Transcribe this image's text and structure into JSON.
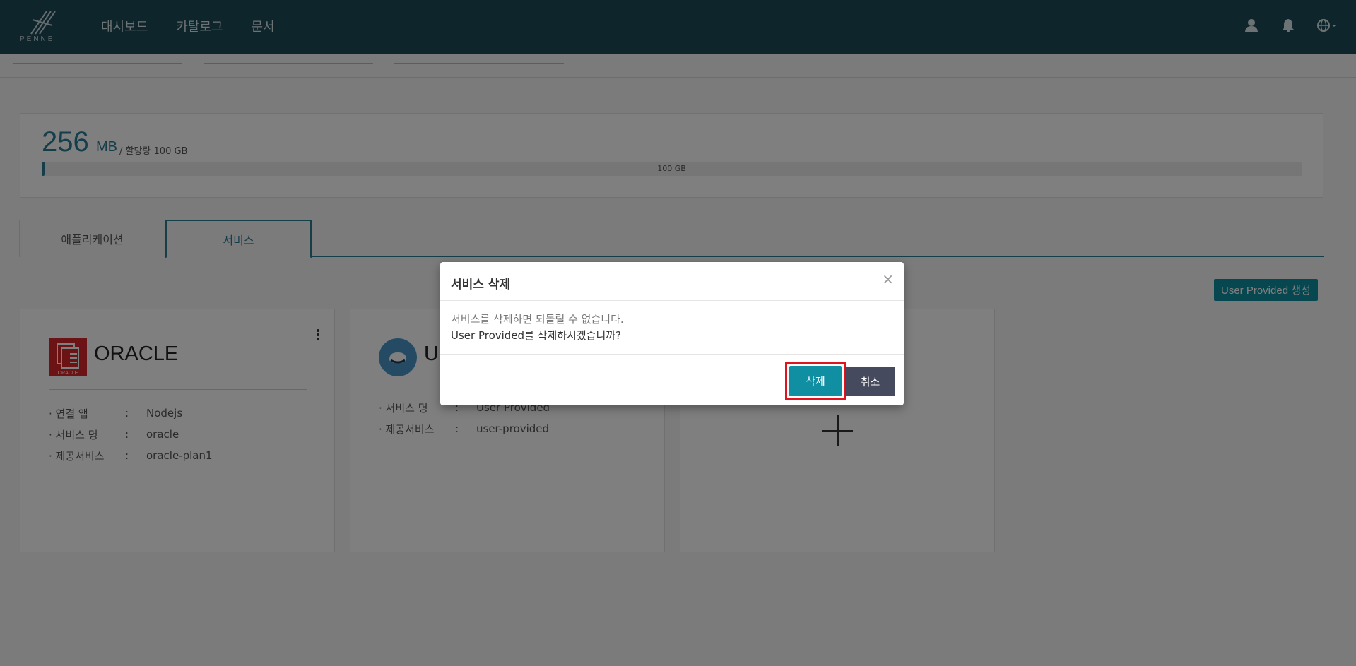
{
  "nav": {
    "logo_text": "PENNE",
    "menu": [
      "대시보드",
      "카탈로그",
      "문서"
    ]
  },
  "usage": {
    "used_value": "256",
    "used_unit": "MB",
    "allocation": "/ 할당량 100 GB",
    "bar_label": "100 GB",
    "used_fraction": 0.0025
  },
  "tabs": [
    "애플리케이션",
    "서비스"
  ],
  "create_button": "User Provided 생성",
  "cards": [
    {
      "name": "ORACLE",
      "logo_caption": "ORACLE",
      "rows": [
        {
          "key": "· 연결 앱",
          "value": "Nodejs"
        },
        {
          "key": "· 서비스 명",
          "value": "oracle"
        },
        {
          "key": "· 제공서비스",
          "value": "oracle-plan1"
        }
      ]
    },
    {
      "name": "U",
      "rows": [
        {
          "key": "· 서비스 명",
          "value": "User Provided"
        },
        {
          "key": "· 제공서비스",
          "value": "user-provided"
        }
      ]
    }
  ],
  "modal": {
    "title": "서비스 삭제",
    "close": "×",
    "line1": "서비스를 삭제하면 되돌릴 수 없습니다.",
    "line2": "User Provided를 삭제하시겠습니까?",
    "delete_label": "삭제",
    "cancel_label": "취소"
  },
  "colors": {
    "nav_bg": "#1b4a57",
    "accent": "#0f8fa1",
    "highlight": "#e0141e",
    "cancel": "#454a5e"
  }
}
